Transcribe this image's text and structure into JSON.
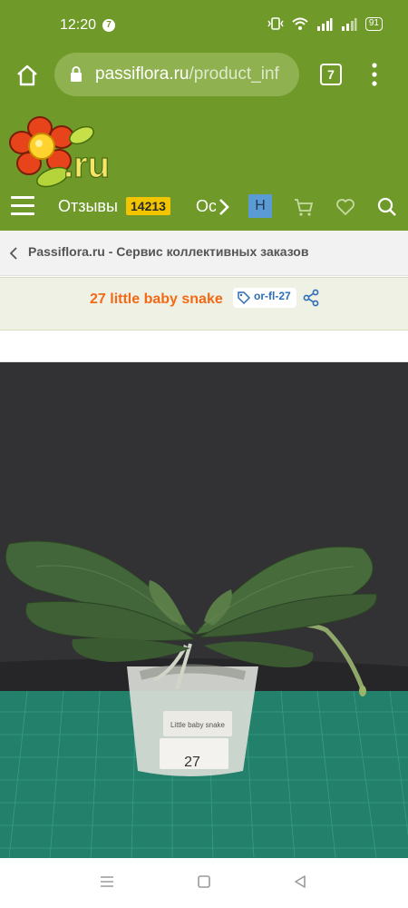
{
  "status_bar": {
    "time": "12:20",
    "notification_count": "7",
    "battery": "91"
  },
  "browser": {
    "url_domain": "passiflora.ru",
    "url_path": "/product_inf",
    "tab_count": "7"
  },
  "site": {
    "logo_text": ".ru",
    "nav": {
      "reviews_label": "Отзывы",
      "reviews_count": "14213",
      "next_item_partial": "Ос",
      "h_button": "Н"
    }
  },
  "breadcrumb": {
    "text": "Passiflora.ru - Сервис коллективных заказов"
  },
  "product": {
    "title": "27 little baby snake",
    "sku": "or-fl-27",
    "photo_tag_number": "27",
    "photo_label_text": "Little baby snake"
  },
  "colors": {
    "brand_green": "#6f9a2a",
    "title_orange": "#f26a17",
    "badge_yellow": "#f2c500",
    "sku_blue": "#2e6db4"
  }
}
